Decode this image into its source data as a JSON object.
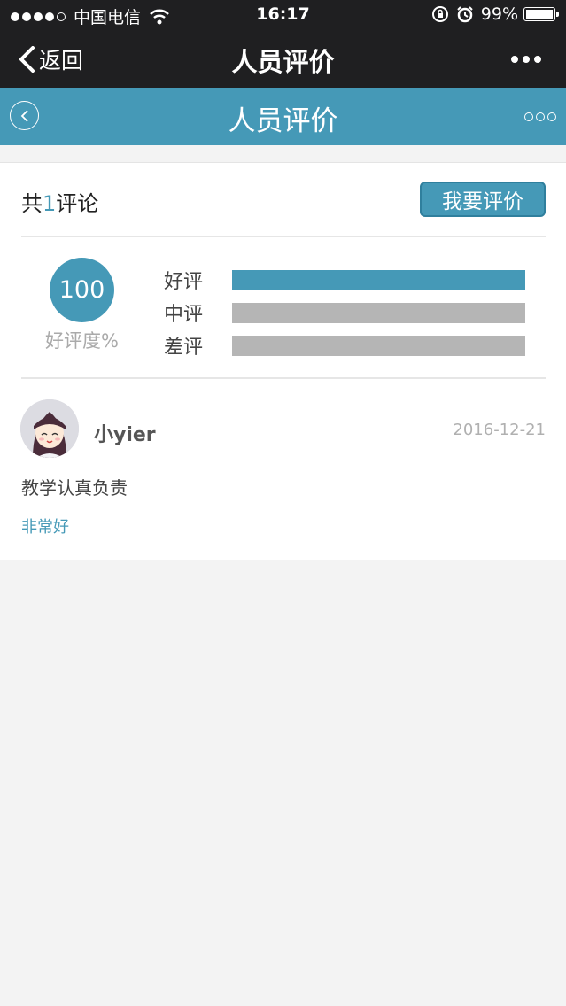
{
  "status_bar": {
    "carrier": "中国电信",
    "time": "16:17",
    "battery": "99%",
    "battery_level": 0.99,
    "signal_bars": 4,
    "icons": [
      "wifi-icon",
      "rotation-lock-icon",
      "alarm-icon",
      "battery-icon"
    ]
  },
  "wechat_nav": {
    "back_label": "返回",
    "title": "人员评价",
    "more_icon": "more-dots-icon"
  },
  "page_header": {
    "title": "人员评价",
    "back_icon": "circle-back-icon",
    "more_icon": "more-circles-icon"
  },
  "summary": {
    "count_prefix": "共",
    "count": "1",
    "count_suffix": "评论",
    "rate_button": "我要评价",
    "score": "100",
    "score_label": "好评度%",
    "ratings": [
      {
        "label": "好评",
        "fraction": 1.0
      },
      {
        "label": "中评",
        "fraction": 0.0
      },
      {
        "label": "差评",
        "fraction": 0.0
      }
    ]
  },
  "reviews": [
    {
      "user": "小yier",
      "date": "2016-12-21",
      "text": "教学认真负责",
      "tag": "非常好"
    }
  ],
  "colors": {
    "accent": "#4599b7",
    "dark_bar": "#1f1f21",
    "background": "#f3f3f3",
    "bar_empty": "#b5b5b5"
  }
}
